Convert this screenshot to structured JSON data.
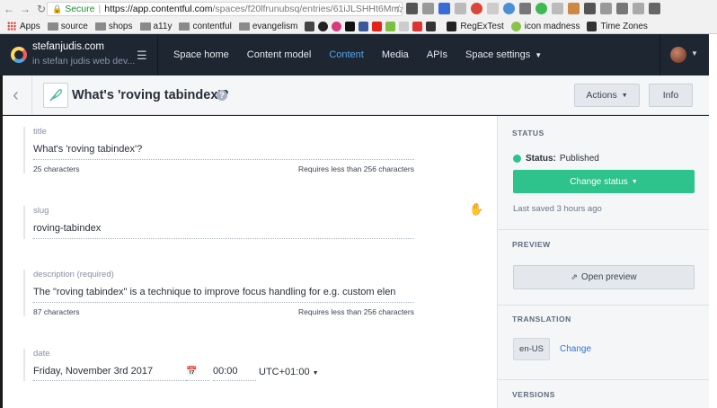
{
  "browser": {
    "secure_label": "Secure",
    "url_host": "https://app.contentful.com",
    "url_path": "/spaces/f20lfrunubsq/entries/61iJLSHHt6Mm...",
    "bookmarks": [
      {
        "label": "Apps",
        "kind": "apps"
      },
      {
        "label": "source",
        "kind": "folder"
      },
      {
        "label": "shops",
        "kind": "folder"
      },
      {
        "label": "a11y",
        "kind": "folder"
      },
      {
        "label": "contentful",
        "kind": "folder"
      },
      {
        "label": "evangelism",
        "kind": "folder"
      },
      {
        "label": "RegExTest",
        "kind": "site"
      },
      {
        "label": "icon madness",
        "kind": "site"
      },
      {
        "label": "Time Zones",
        "kind": "site"
      }
    ]
  },
  "topnav": {
    "space_name": "stefanjudis.com",
    "space_sub": "in stefan judis web dev...",
    "items": [
      {
        "label": "Space home",
        "active": false
      },
      {
        "label": "Content model",
        "active": false
      },
      {
        "label": "Content",
        "active": true
      },
      {
        "label": "Media",
        "active": false
      },
      {
        "label": "APIs",
        "active": false
      },
      {
        "label": "Space settings",
        "active": false
      }
    ]
  },
  "entry": {
    "title": "What's 'roving tabindex'?",
    "actions_label": "Actions",
    "info_label": "Info"
  },
  "fields": {
    "title": {
      "label": "title",
      "value_pre": "What's 'roving ",
      "value_squiggle": "tabindex",
      "value_post": "'?",
      "count": "25 characters",
      "limit": "Requires less than 256 characters"
    },
    "slug": {
      "label": "slug",
      "value": "roving-tabindex"
    },
    "description": {
      "label": "description (required)",
      "value": "The \"roving tabindex\" is a technique to improve focus handling for e.g. custom elen",
      "count": "87 characters",
      "limit": "Requires less than 256 characters"
    },
    "date": {
      "label": "date",
      "date": "Friday, November 3rd 2017",
      "time": "00:00",
      "tz": "UTC+01:00"
    }
  },
  "sidebar": {
    "status_heading": "STATUS",
    "status_key": "Status:",
    "status_value": "Published",
    "change_status": "Change status",
    "last_saved": "Last saved 3 hours ago",
    "preview_heading": "PREVIEW",
    "open_preview": "Open preview",
    "translation_heading": "TRANSLATION",
    "locale": "en-US",
    "change_link": "Change",
    "versions_heading": "VERSIONS"
  },
  "colors": {
    "topbar": "#1d2631",
    "active_nav": "#56a6ef",
    "published": "#2ec28c",
    "link": "#2e75d4"
  }
}
